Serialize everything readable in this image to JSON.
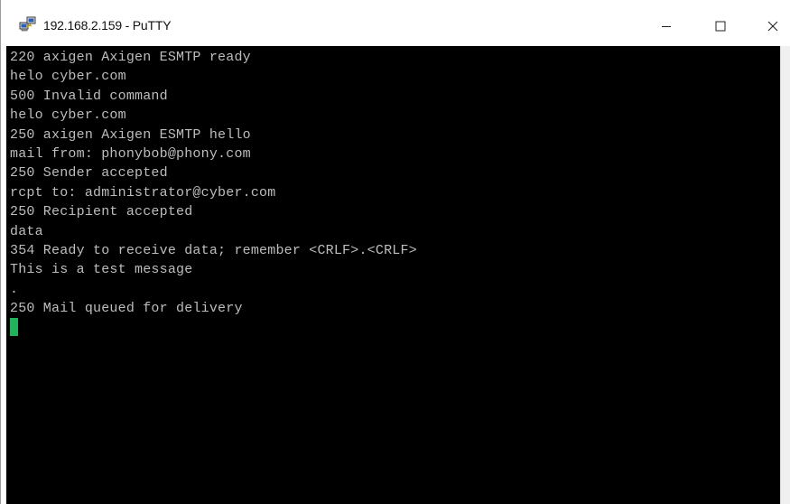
{
  "window": {
    "title": "192.168.2.159 - PuTTY",
    "icon": "putty-computers-icon",
    "controls": {
      "minimize_icon": "minimize-icon",
      "maximize_icon": "maximize-icon",
      "close_icon": "close-icon"
    }
  },
  "terminal": {
    "background": "#000000",
    "text_color": "#bdbdbd",
    "cursor_color": "#20b35a",
    "lines": [
      "220 axigen Axigen ESMTP ready",
      "helo cyber.com",
      "500 Invalid command",
      "helo cyber.com",
      "250 axigen Axigen ESMTP hello",
      "mail from: phonybob@phony.com",
      "250 Sender accepted",
      "rcpt to: administrator@cyber.com",
      "250 Recipient accepted",
      "data",
      "354 Ready to receive data; remember <CRLF>.<CRLF>",
      "This is a test message",
      ".",
      "250 Mail queued for delivery"
    ]
  }
}
